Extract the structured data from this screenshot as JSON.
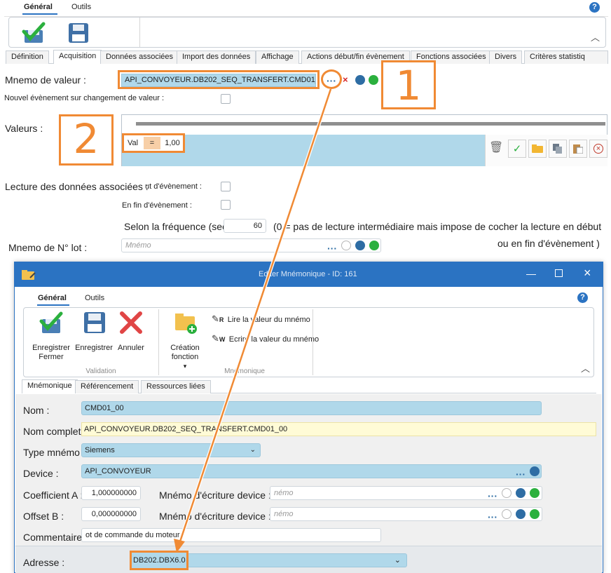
{
  "top_tabs": {
    "general": "Général",
    "outils": "Outils"
  },
  "sub_tabs": [
    "Définition",
    "Acquisition",
    "Données associées",
    "Import des données",
    "Affichage",
    "Actions début/fin évènement",
    "Fonctions associées",
    "Divers",
    "Critères statistiq"
  ],
  "acq": {
    "mnemo_label": "Mnemo de valeur :",
    "mnemo_value": "API_CONVOYEUR.DB202_SEQ_TRANSFERT.CMD01_00",
    "nouvel_label": "Nouvel évènement sur changement de valeur :",
    "valeurs_label": "Valeurs :",
    "cond_var": "Val",
    "cond_op": "=",
    "cond_val": "1,00",
    "lecture_label": "Lecture des données associées :",
    "debut_label": "ut d'évènement :",
    "fin_label": "En fin d'évènement :",
    "freq_label": "Selon la fréquence (sec",
    "freq_value": "60",
    "freq_note1": "(0 = pas de lecture intermédiaire mais impose de cocher la lecture en début",
    "freq_note2": "ou en fin d'évènement )",
    "lot_label": "Mnemo de N° lot :",
    "lot_placeholder": "Mnémo"
  },
  "callouts": {
    "one": "1",
    "two": "2"
  },
  "dialog": {
    "title": "Editer Mnémonique - ID: 161",
    "tabs": {
      "general": "Général",
      "outils": "Outils"
    },
    "ribbon": {
      "save_close": "Enregistrer Fermer",
      "save": "Enregistrer",
      "cancel": "Annuler",
      "validation_group": "Validation",
      "create_fn": "Création fonction",
      "read_value": "Lire la valeur du mnémo",
      "write_value": "Ecrire la valeur du mnémo",
      "mnemo_group": "Mnémonique",
      "read_letter": "R",
      "write_letter": "W"
    },
    "subtabs": [
      "Mnémonique",
      "Référencement",
      "Ressources liées"
    ],
    "fields": {
      "nom_label": "Nom :",
      "nom_value": "CMD01_00",
      "nomc_label": "Nom complet :",
      "nomc_value": "API_CONVOYEUR.DB202_SEQ_TRANSFERT.CMD01_00",
      "type_label": "Type mnémo :",
      "type_value": "Siemens",
      "device_label": "Device :",
      "device_value": "API_CONVOYEUR",
      "coefa_label": "Coefficient A :",
      "coefa_value": "1,000000000",
      "offb_label": "Offset B :",
      "offb_value": "0,000000000",
      "mnemo_ecr_label": "Mnémo d'écriture device :",
      "mnemo_ecr_placeholder": "némo",
      "comment_label": "Commentaire :",
      "comment_value": "ot de commande du moteur",
      "adresse_label": "Adresse :",
      "adresse_value": "DB202.DBX6.0"
    }
  },
  "colors": {
    "accent": "#2b73c2",
    "orange": "#f08a34",
    "field_blue": "#b0d8ea"
  }
}
